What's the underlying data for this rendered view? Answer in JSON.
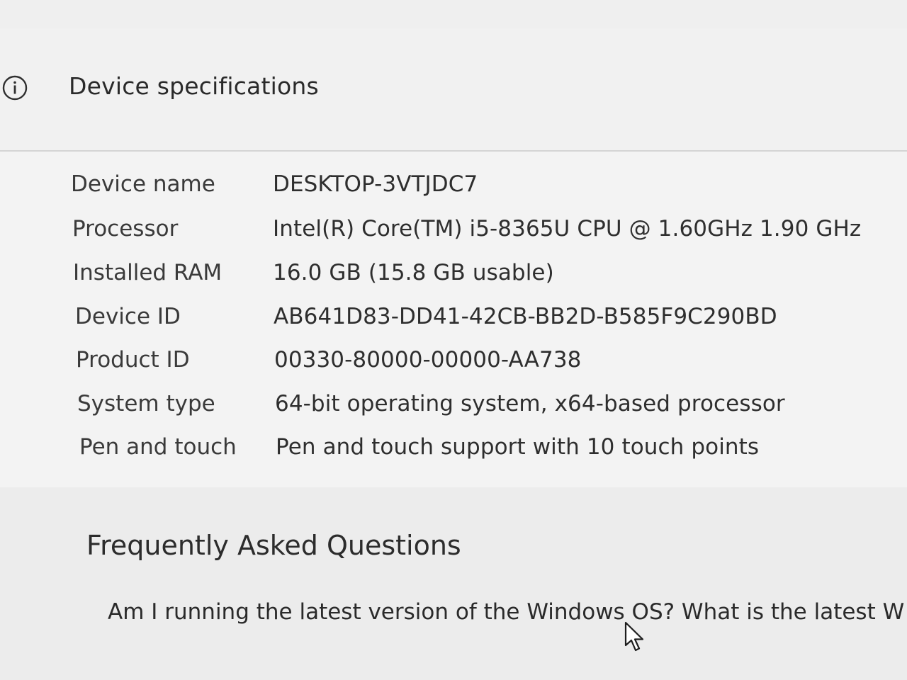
{
  "header": {
    "icon": "info-icon",
    "title": "Device specifications"
  },
  "specs": [
    {
      "label": "Device name",
      "value": "DESKTOP-3VTJDC7"
    },
    {
      "label": "Processor",
      "value": "Intel(R) Core(TM) i5-8365U CPU @ 1.60GHz   1.90 GHz"
    },
    {
      "label": "Installed RAM",
      "value": "16.0 GB (15.8 GB usable)"
    },
    {
      "label": "Device ID",
      "value": "AB641D83-DD41-42CB-BB2D-B585F9C290BD"
    },
    {
      "label": "Product ID",
      "value": "00330-80000-00000-AA738"
    },
    {
      "label": "System type",
      "value": "64-bit operating system, x64-based processor"
    },
    {
      "label": "Pen and touch",
      "value": "Pen and touch support with 10 touch points"
    }
  ],
  "faq": {
    "title": "Frequently Asked Questions",
    "items": [
      {
        "text": "Am I running the latest version of the Windows OS? What is the latest W"
      }
    ]
  },
  "cursor": {
    "icon": "mouse-pointer-icon"
  }
}
